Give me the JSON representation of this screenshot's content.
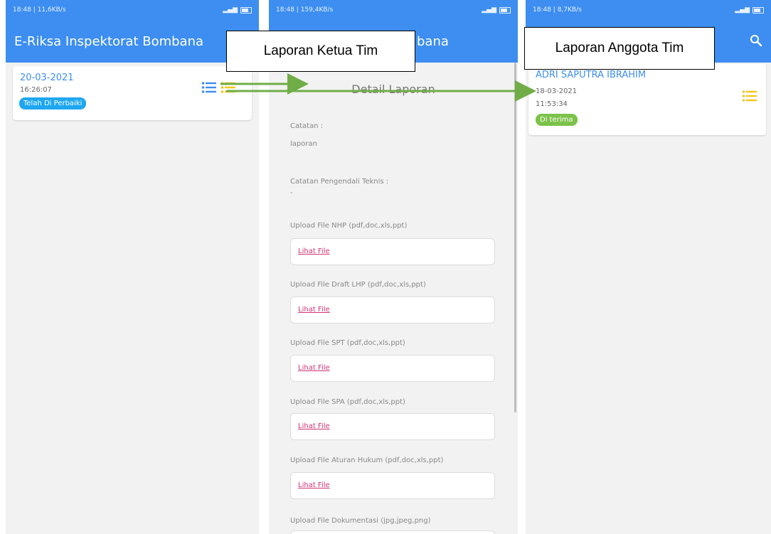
{
  "colors": {
    "primary": "#3d8ef0",
    "badge_blue": "#1ea7f0",
    "badge_green": "#7cc24a",
    "link": "#d03377",
    "icon_yellow": "#f5c518",
    "arrow_green": "#70ad47"
  },
  "screen1": {
    "status_time": "18:48 | 11,6KB/s",
    "app_title": "E-Riksa Inspektorat Bombana",
    "card": {
      "date": "20-03-2021",
      "time": "16:26:07",
      "badge": "Telah Di Perbaiki",
      "icons": [
        "list-blue-icon",
        "list-yellow-icon"
      ]
    }
  },
  "screen2": {
    "status_time": "18:48 | 159,4KB/s",
    "app_title_visible": "bana",
    "detail_title": "Detail Laporan",
    "catatan_label": "Catatan :",
    "catatan_value": "laporan",
    "catatan_pengendali_label": "Catatan Pengendali Teknis :",
    "catatan_pengendali_value": "-",
    "uploads": [
      {
        "label": "Upload File NHP (pdf,doc,xls,ppt)",
        "link": "Lihat File"
      },
      {
        "label": "Upload File Draft LHP (pdf,doc,xls,ppt)",
        "link": "Lihat File"
      },
      {
        "label": "Upload File SPT (pdf,doc,xls,ppt)",
        "link": "Lihat File"
      },
      {
        "label": "Upload File SPA (pdf,doc,xls,ppt)",
        "link": "Lihat File"
      },
      {
        "label": "Upload File Aturan Hukum (pdf,doc,xls,ppt)",
        "link": "Lihat File"
      },
      {
        "label": "Upload File Dokumentasi (jpg,jpeg,png)",
        "link": ""
      }
    ]
  },
  "screen3": {
    "status_time": "18:48 | 8,7KB/s",
    "card": {
      "name": "ADRI SAPUTRA IBRAHIM",
      "date": "18-03-2021",
      "time": "11:53:34",
      "badge": "Di terima",
      "icon": "list-yellow-icon"
    }
  },
  "callouts": {
    "ketua": "Laporan Ketua Tim",
    "anggota": "Laporan Anggota Tim"
  }
}
